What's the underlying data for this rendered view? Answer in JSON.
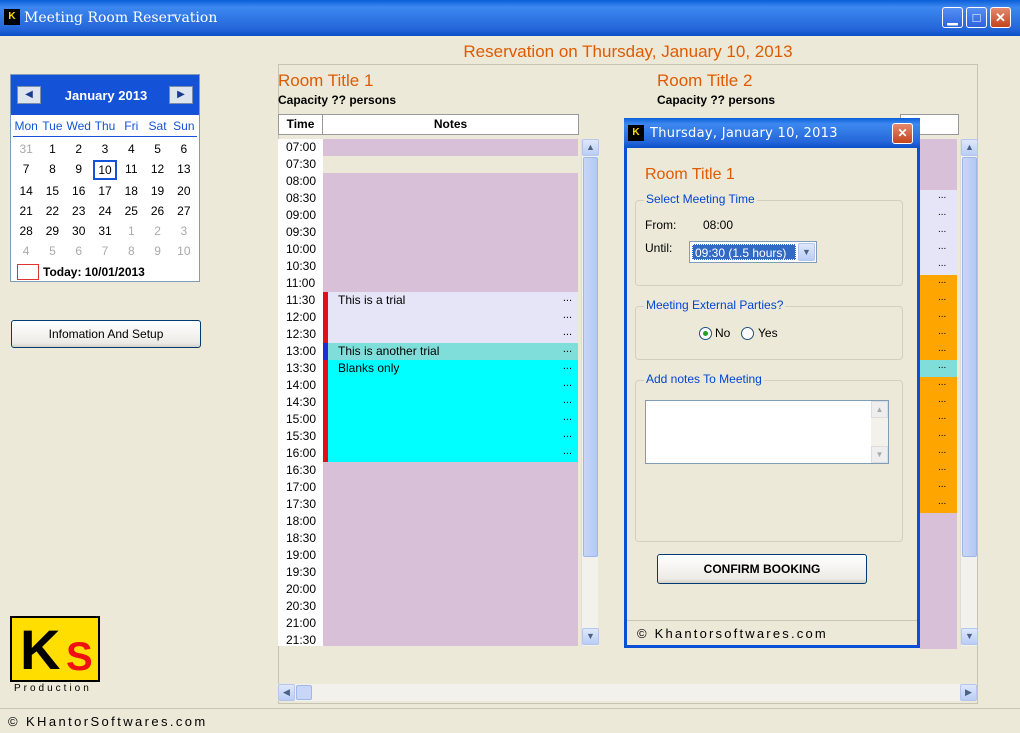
{
  "window": {
    "title": "Meeting Room Reservation",
    "icon_label": "K",
    "minimize": "▁",
    "maximize": "□",
    "close": "✕"
  },
  "heading": "Reservation on Thursday, January 10, 2013",
  "calendar": {
    "month_label": "January 2013",
    "prev": "◀",
    "next": "▶",
    "dows": [
      "Mon",
      "Tue",
      "Wed",
      "Thu",
      "Fri",
      "Sat",
      "Sun"
    ],
    "days": [
      {
        "d": "31",
        "other": true
      },
      {
        "d": "1"
      },
      {
        "d": "2"
      },
      {
        "d": "3"
      },
      {
        "d": "4"
      },
      {
        "d": "5"
      },
      {
        "d": "6"
      },
      {
        "d": "7"
      },
      {
        "d": "8"
      },
      {
        "d": "9"
      },
      {
        "d": "10",
        "selected": true
      },
      {
        "d": "11"
      },
      {
        "d": "12"
      },
      {
        "d": "13"
      },
      {
        "d": "14"
      },
      {
        "d": "15"
      },
      {
        "d": "16"
      },
      {
        "d": "17"
      },
      {
        "d": "18"
      },
      {
        "d": "19"
      },
      {
        "d": "20"
      },
      {
        "d": "21"
      },
      {
        "d": "22"
      },
      {
        "d": "23"
      },
      {
        "d": "24"
      },
      {
        "d": "25"
      },
      {
        "d": "26"
      },
      {
        "d": "27"
      },
      {
        "d": "28"
      },
      {
        "d": "29"
      },
      {
        "d": "30"
      },
      {
        "d": "31"
      },
      {
        "d": "1",
        "other": true
      },
      {
        "d": "2",
        "other": true
      },
      {
        "d": "3",
        "other": true
      },
      {
        "d": "4",
        "other": true
      },
      {
        "d": "5",
        "other": true
      },
      {
        "d": "6",
        "other": true
      },
      {
        "d": "7",
        "other": true
      },
      {
        "d": "8",
        "other": true
      },
      {
        "d": "9",
        "other": true
      },
      {
        "d": "10",
        "other": true
      }
    ],
    "today_label": "Today: 10/01/2013"
  },
  "info_button": "Infomation And Setup",
  "logo": {
    "k": "K",
    "s": "S",
    "production": "Production"
  },
  "rooms": [
    {
      "title": "Room Title 1",
      "capacity": "Capacity ?? persons"
    },
    {
      "title": "Room Title 2",
      "capacity": "Capacity ?? persons"
    }
  ],
  "columns": {
    "time": "Time",
    "notes": "Notes"
  },
  "colors": {
    "empty_slot": "#d8c1d8",
    "empty_slot_light": "#ece9d8",
    "booked_light": "#e5e5f7",
    "booked_teal": "#80deda",
    "booked_cyan": "#00ffff",
    "marker_red": "#e0101a",
    "marker_blue": "#1a2fd8",
    "room2_orange": "#ffa500"
  },
  "schedule": [
    {
      "time": "07:00",
      "kind": "empty",
      "text": "",
      "dots": ""
    },
    {
      "time": "07:30",
      "kind": "empty_light",
      "text": "",
      "dots": ""
    },
    {
      "time": "08:00",
      "kind": "empty",
      "text": "",
      "dots": ""
    },
    {
      "time": "08:30",
      "kind": "empty",
      "text": "",
      "dots": ""
    },
    {
      "time": "09:00",
      "kind": "empty",
      "text": "",
      "dots": ""
    },
    {
      "time": "09:30",
      "kind": "empty",
      "text": "",
      "dots": ""
    },
    {
      "time": "10:00",
      "kind": "empty",
      "text": "",
      "dots": ""
    },
    {
      "time": "10:30",
      "kind": "empty",
      "text": "",
      "dots": ""
    },
    {
      "time": "11:00",
      "kind": "empty",
      "text": "",
      "dots": ""
    },
    {
      "time": "11:30",
      "kind": "booked_light",
      "marker": "red",
      "text": "This is a trial",
      "dots": "..."
    },
    {
      "time": "12:00",
      "kind": "booked_light",
      "marker": "red",
      "text": "",
      "dots": "..."
    },
    {
      "time": "12:30",
      "kind": "booked_light",
      "marker": "red",
      "text": "",
      "dots": "..."
    },
    {
      "time": "13:00",
      "kind": "booked_teal",
      "marker": "blue",
      "text": "This is another trial",
      "dots": "..."
    },
    {
      "time": "13:30",
      "kind": "booked_cyan",
      "marker": "red",
      "text": "Blanks only",
      "dots": "..."
    },
    {
      "time": "14:00",
      "kind": "booked_cyan",
      "marker": "red",
      "text": "",
      "dots": "..."
    },
    {
      "time": "14:30",
      "kind": "booked_cyan",
      "marker": "red",
      "text": "",
      "dots": "..."
    },
    {
      "time": "15:00",
      "kind": "booked_cyan",
      "marker": "red",
      "text": "",
      "dots": "..."
    },
    {
      "time": "15:30",
      "kind": "booked_cyan",
      "marker": "red",
      "text": "",
      "dots": "..."
    },
    {
      "time": "16:00",
      "kind": "booked_cyan",
      "marker": "red",
      "text": "",
      "dots": "..."
    },
    {
      "time": "16:30",
      "kind": "empty",
      "text": "",
      "dots": ""
    },
    {
      "time": "17:00",
      "kind": "empty",
      "text": "",
      "dots": ""
    },
    {
      "time": "17:30",
      "kind": "empty",
      "text": "",
      "dots": ""
    },
    {
      "time": "18:00",
      "kind": "empty",
      "text": "",
      "dots": ""
    },
    {
      "time": "18:30",
      "kind": "empty",
      "text": "",
      "dots": ""
    },
    {
      "time": "19:00",
      "kind": "empty",
      "text": "",
      "dots": ""
    },
    {
      "time": "19:30",
      "kind": "empty",
      "text": "",
      "dots": ""
    },
    {
      "time": "20:00",
      "kind": "empty",
      "text": "",
      "dots": ""
    },
    {
      "time": "20:30",
      "kind": "empty",
      "text": "",
      "dots": ""
    },
    {
      "time": "21:00",
      "kind": "empty",
      "text": "",
      "dots": ""
    },
    {
      "time": "21:30",
      "kind": "empty",
      "text": "",
      "dots": ""
    }
  ],
  "room2_slots": [
    "empty",
    "empty",
    "empty",
    "light",
    "light",
    "light",
    "light",
    "light",
    "orange",
    "orange",
    "orange",
    "orange",
    "orange",
    "teal",
    "orange",
    "orange",
    "orange",
    "orange",
    "orange",
    "orange",
    "orange",
    "orange",
    "empty",
    "empty",
    "empty",
    "empty",
    "empty",
    "empty",
    "empty",
    "empty"
  ],
  "scroll": {
    "up": "▲",
    "down": "▼",
    "left": "◀",
    "right": "▶"
  },
  "dialog": {
    "title": "Thursday, January 10, 2013",
    "close": "✕",
    "room": "Room Title 1",
    "time_group": "Select Meeting Time",
    "from_label": "From:",
    "from_value": "08:00",
    "until_label": "Until:",
    "until_value": "09:30 (1.5 hours)",
    "external_group": "Meeting External Parties?",
    "no_label": "No",
    "yes_label": "Yes",
    "notes_group": "Add notes To Meeting",
    "notes_value": "",
    "confirm": "CONFIRM BOOKING",
    "status": "©  Khantorsoftwares.com"
  },
  "status_bar": "©  KHantorSoftwares.com"
}
